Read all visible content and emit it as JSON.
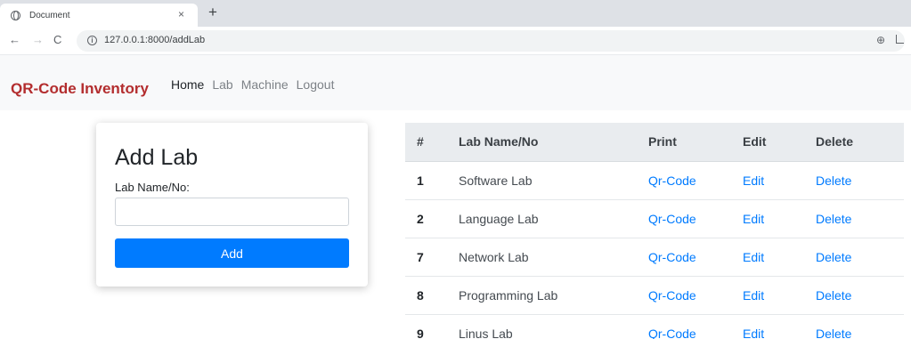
{
  "browser": {
    "tab_title": "Document",
    "tab_close": "×",
    "new_tab": "+",
    "url": "127.0.0.1:8000/addLab",
    "icons": [
      "globe-icon",
      "close-icon",
      "plus-icon",
      "back-arrow-icon",
      "forward-arrow-icon",
      "reload-icon",
      "info-icon",
      "zoom-icon",
      "share-icon"
    ]
  },
  "navbar": {
    "brand": "QR-Code Inventory",
    "links": [
      "Home",
      "Lab",
      "Machine",
      "Logout"
    ],
    "active": "Home",
    "brand_color": "#b32d2e"
  },
  "form": {
    "title": "Add Lab",
    "label": "Lab Name/No:",
    "input_value": "",
    "button_label": "Add",
    "button_color": "#007bff"
  },
  "table": {
    "headers": [
      "#",
      "Lab Name/No",
      "Print",
      "Edit",
      "Delete"
    ],
    "rows": [
      {
        "id": "1",
        "name": "Software Lab",
        "print": "Qr-Code",
        "edit": "Edit",
        "delete": "Delete"
      },
      {
        "id": "2",
        "name": "Language Lab",
        "print": "Qr-Code",
        "edit": "Edit",
        "delete": "Delete"
      },
      {
        "id": "7",
        "name": "Network Lab",
        "print": "Qr-Code",
        "edit": "Edit",
        "delete": "Delete"
      },
      {
        "id": "8",
        "name": "Programming Lab",
        "print": "Qr-Code",
        "edit": "Edit",
        "delete": "Delete"
      },
      {
        "id": "9",
        "name": "Linus Lab",
        "print": "Qr-Code",
        "edit": "Edit",
        "delete": "Delete"
      }
    ],
    "link_color": "#007bff"
  }
}
